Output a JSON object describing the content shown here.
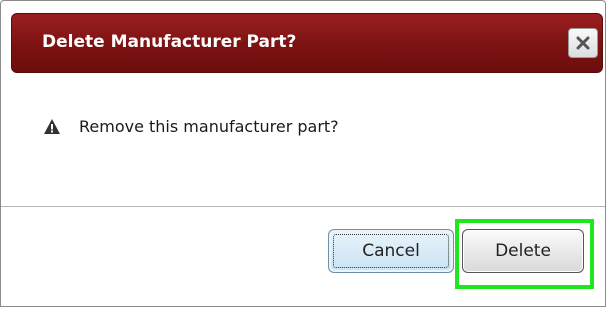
{
  "dialog": {
    "title": "Delete Manufacturer Part?",
    "close_icon": "close-x-icon",
    "message": "Remove this manufacturer part?",
    "message_icon": "warning-triangle-icon",
    "buttons": {
      "cancel_label": "Cancel",
      "delete_label": "Delete"
    }
  },
  "colors": {
    "titlebar": "#7c1212",
    "highlight": "#1de81d",
    "cancel_button": "#c9e2f3"
  }
}
